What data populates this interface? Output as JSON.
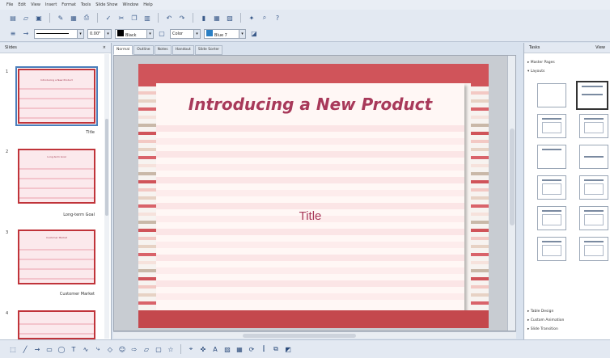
{
  "menubar": {
    "items": [
      "File",
      "Edit",
      "View",
      "Insert",
      "Format",
      "Tools",
      "Slide Show",
      "Window",
      "Help"
    ]
  },
  "toolbar2": {
    "line_width": "0.00\"",
    "line_color": "Black",
    "area_style": "Color",
    "area_color": "Blue 7"
  },
  "slides_pane": {
    "title": "Slides",
    "slides": [
      {
        "number": "1",
        "caption": "Title",
        "thumb_title": "Introducing a New Product"
      },
      {
        "number": "2",
        "caption": "Long-term Goal",
        "thumb_title": "Long-term Goal"
      },
      {
        "number": "3",
        "caption": "Customer Market",
        "thumb_title": "Customer Market"
      },
      {
        "number": "4",
        "caption": "",
        "thumb_title": ""
      }
    ]
  },
  "view_tabs": [
    "Normal",
    "Outline",
    "Notes",
    "Handout",
    "Slide Sorter"
  ],
  "slide": {
    "title": "Introducing a New Product",
    "subtitle": "Title"
  },
  "tasks_pane": {
    "title": "Tasks",
    "view_label": "View",
    "sections": [
      "Master Pages",
      "Layouts",
      "Table Design",
      "Custom Animation",
      "Slide Transition"
    ]
  },
  "colors": {
    "accent": "#a8395a",
    "band": "#d0545a"
  }
}
